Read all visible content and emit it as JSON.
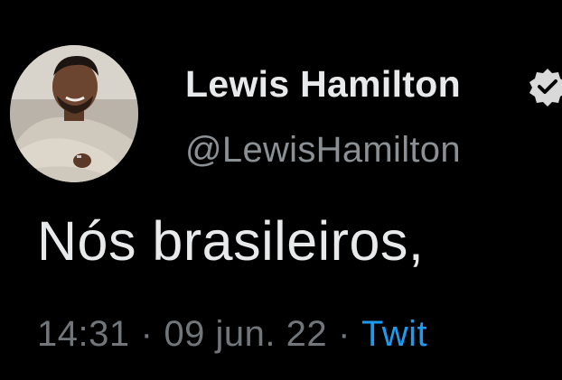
{
  "tweet": {
    "author": {
      "name": "Lewis Hamilton",
      "handle": "@LewisHamilton",
      "verified_icon": "verified-badge-icon",
      "avatar_icon": "profile-photo"
    },
    "text": "Nós brasileiros,",
    "meta": {
      "time": "14:31",
      "separator": "·",
      "date": "09 jun. 22",
      "source": "Twit"
    }
  },
  "colors": {
    "background": "#000000",
    "primary_text": "#e7e9ea",
    "secondary_text": "#71767b",
    "link": "#1d9bf0"
  }
}
